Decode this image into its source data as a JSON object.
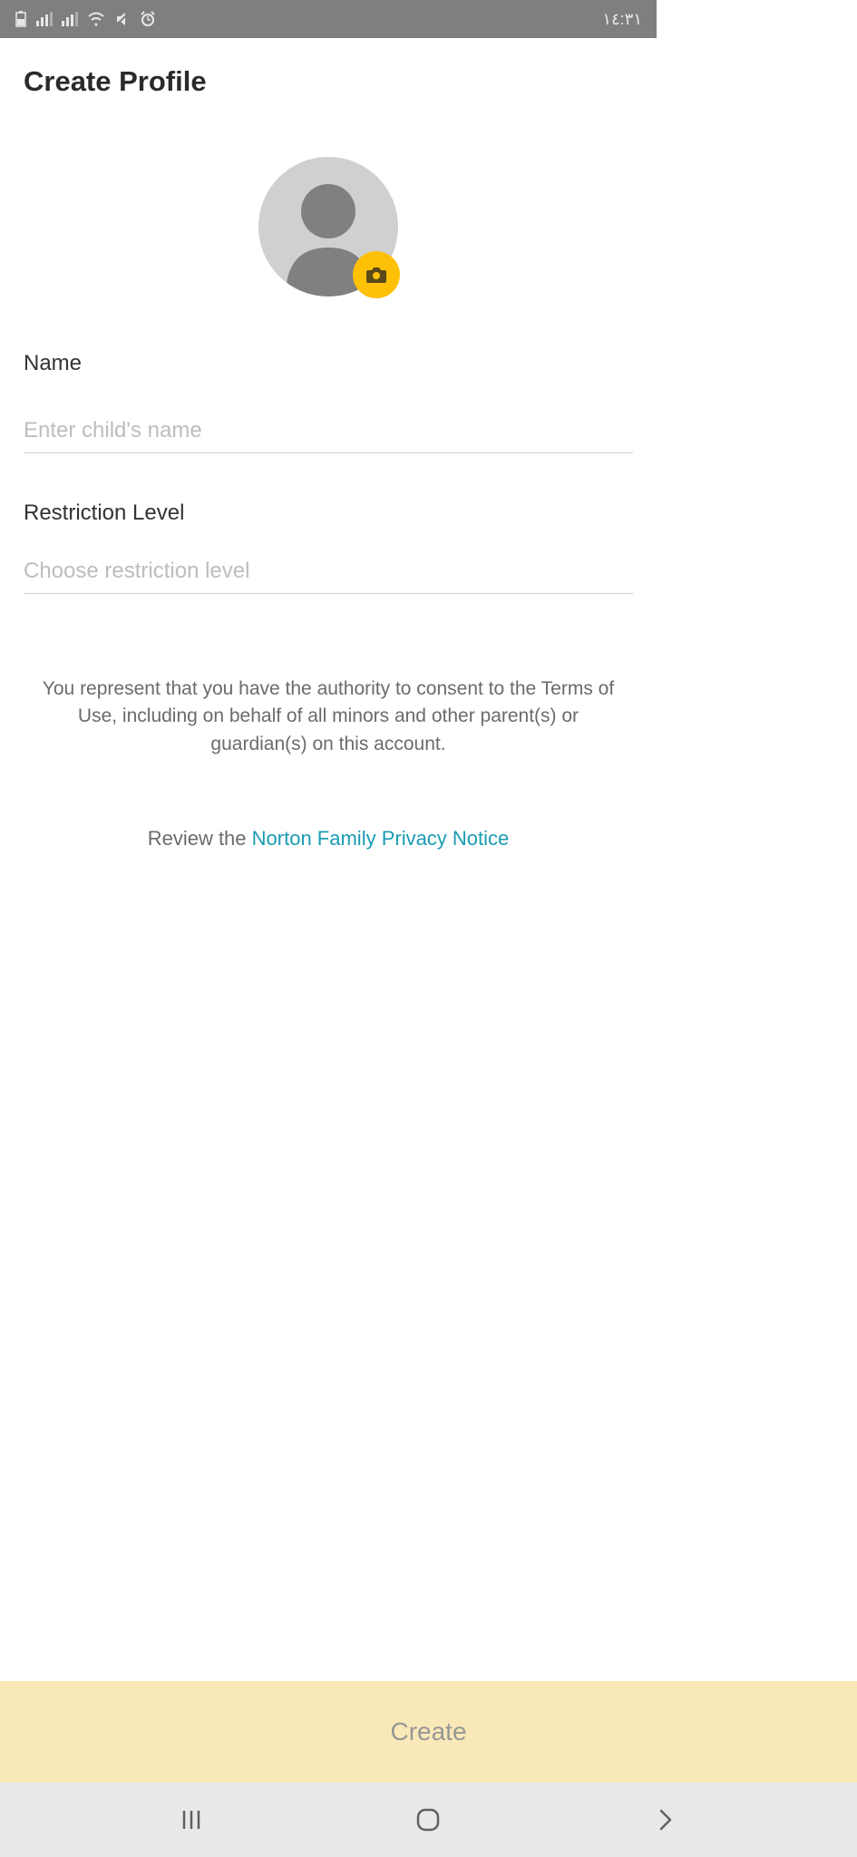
{
  "statusBar": {
    "time": "١٤:٣١"
  },
  "page": {
    "title": "Create Profile"
  },
  "form": {
    "nameLabel": "Name",
    "namePlaceholder": "Enter child's name",
    "nameValue": "",
    "restrictionLabel": "Restriction Level",
    "restrictionPlaceholder": "Choose restriction level"
  },
  "disclaimer": "You represent that you have the authority to consent to the Terms of Use, including on behalf of all minors and other parent(s) or guardian(s) on this account.",
  "review": {
    "prefix": "Review the ",
    "linkText": "Norton Family Privacy Notice"
  },
  "actions": {
    "createLabel": "Create"
  }
}
